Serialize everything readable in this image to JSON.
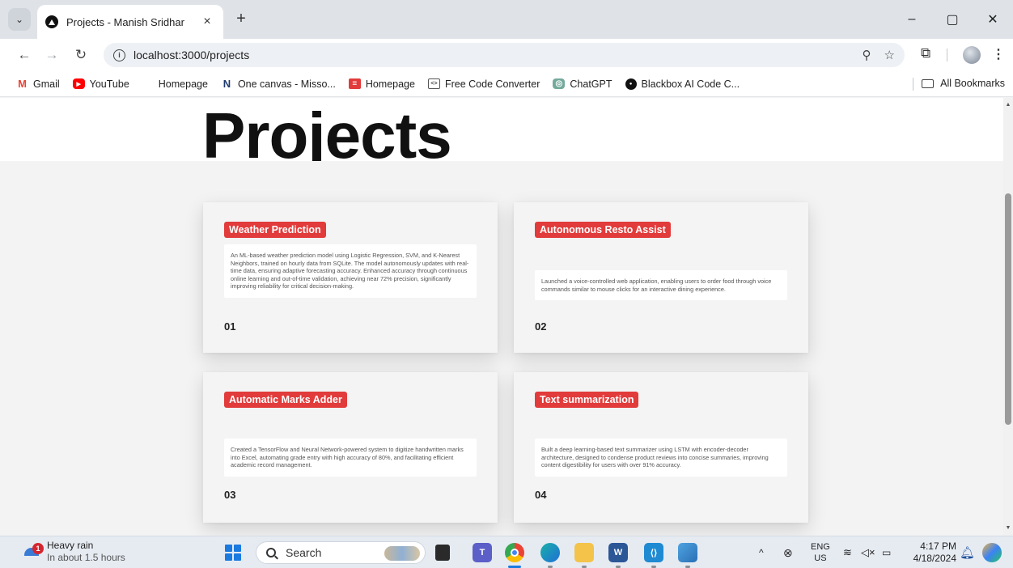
{
  "browser": {
    "tab_title": "Projects - Manish Sridhar",
    "tab_close": "×",
    "new_tab": "+",
    "url": "localhost:3000/projects",
    "window": {
      "minimize": "–",
      "restore": "▢",
      "close": "✕"
    },
    "nav": {
      "back": "←",
      "forward": "→",
      "reload": "↻"
    },
    "bookmarks": [
      {
        "label": "Gmail",
        "icon": "gmail-icon",
        "color": "#ea4335",
        "glyph": "M"
      },
      {
        "label": "YouTube",
        "icon": "youtube-icon",
        "color": "#ff0000",
        "glyph": "▶"
      },
      {
        "label": "Homepage",
        "icon": "microsoft-icon",
        "color": "#f25022",
        "glyph": ""
      },
      {
        "label": "One canvas - Misso...",
        "icon": "canvas-icon",
        "color": "#1f3a6d",
        "glyph": "N"
      },
      {
        "label": "Homepage",
        "icon": "homepage-icon",
        "color": "#e23b3b",
        "glyph": "≡"
      },
      {
        "label": "Free Code Converter",
        "icon": "code-converter-icon",
        "color": "#555555",
        "glyph": "<>"
      },
      {
        "label": "ChatGPT",
        "icon": "chatgpt-icon",
        "color": "#74aa9c",
        "glyph": "◎"
      },
      {
        "label": "Blackbox AI Code C...",
        "icon": "blackbox-icon",
        "color": "#111111",
        "glyph": "●"
      }
    ],
    "all_bookmarks": "All Bookmarks"
  },
  "page": {
    "title": "Projects",
    "accent": "#e23b3b",
    "projects": [
      {
        "name": "Weather Prediction",
        "description": "An ML-based weather prediction model using Logistic Regression, SVM, and K-Nearest Neighbors, trained on hourly data from SQLite. The model autonomously updates with real-time data, ensuring adaptive forecasting accuracy. Enhanced accuracy through continuous online learning and out-of-time validation, achieving near 72% precision, significantly improving reliability for critical decision-making.",
        "number": "01"
      },
      {
        "name": "Autonomous Resto Assist",
        "description": "Launched a voice-controlled web application, enabling users to order food through voice commands similar to mouse clicks for an interactive dining experience.",
        "number": "02"
      },
      {
        "name": "Automatic Marks Adder",
        "description": "Created a TensorFlow and Neural Network-powered system to digitize handwritten marks into Excel, automating grade entry with high accuracy of 80%, and facilitating efficient academic record management.",
        "number": "03"
      },
      {
        "name": "Text summarization",
        "description": "Built a deep learning-based text summarizer using LSTM with encoder-decoder architecture, designed to condense product reviews into concise summaries, improving content digestibility for users with over 91% accuracy.",
        "number": "04"
      }
    ]
  },
  "taskbar": {
    "weather_title": "Heavy rain",
    "weather_sub": "In about 1.5 hours",
    "weather_badge": "1",
    "search_label": "Search",
    "lang_top": "ENG",
    "lang_bottom": "US",
    "time": "4:17 PM",
    "date": "4/18/2024",
    "tray_chevron": "^"
  }
}
